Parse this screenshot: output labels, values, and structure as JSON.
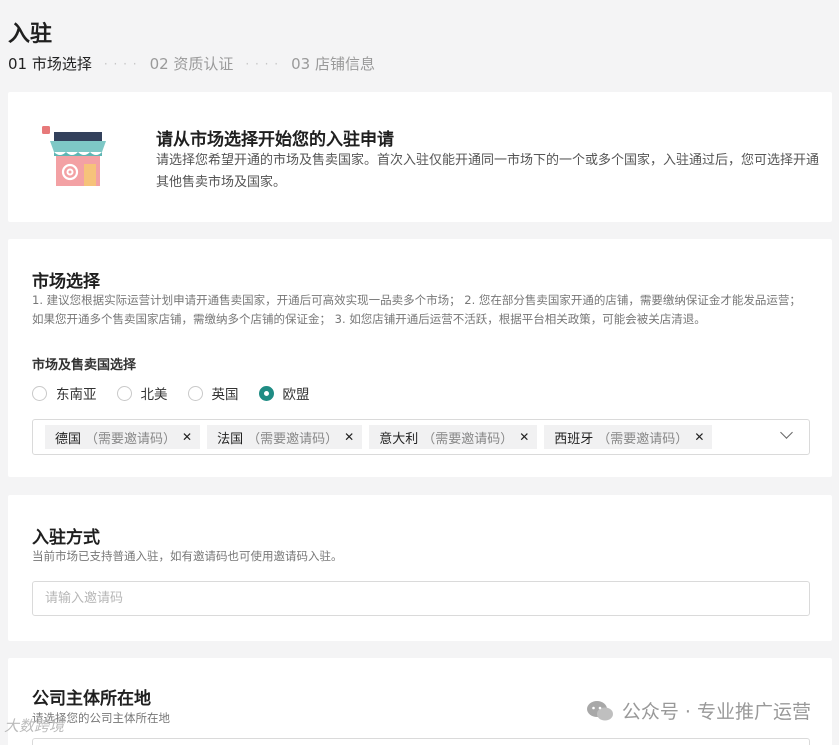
{
  "page": {
    "title": "入驻",
    "steps": [
      {
        "label": "01 市场选择"
      },
      {
        "label": "02 资质认证"
      },
      {
        "label": "03 店铺信息"
      }
    ]
  },
  "intro": {
    "icon": "shop-icon",
    "title": "请从市场选择开始您的入驻申请",
    "desc": "请选择您希望开通的市场及售卖国家。首次入驻仅能开通同一市场下的一个或多个国家，入驻通过后，您可选择开通其他售卖市场及国家。"
  },
  "market": {
    "title": "市场选择",
    "desc": "1. 建议您根据实际运营计划申请开通售卖国家，开通后可高效实现一品卖多个市场； 2. 您在部分售卖国家开通的店铺，需要缴纳保证金才能发品运营；如果您开通多个售卖国家店铺，需缴纳多个店铺的保证金； 3. 如您店铺开通后运营不活跃，根据平台相关政策，可能会被关店清退。",
    "select_label": "市场及售卖国选择",
    "options": [
      {
        "label": "东南亚",
        "checked": false
      },
      {
        "label": "北美",
        "checked": false
      },
      {
        "label": "英国",
        "checked": false
      },
      {
        "label": "欧盟",
        "checked": true
      }
    ],
    "selected_countries": [
      {
        "name": "德国",
        "note": "（需要邀请码）"
      },
      {
        "name": "法国",
        "note": "（需要邀请码）"
      },
      {
        "name": "意大利",
        "note": "（需要邀请码）"
      },
      {
        "name": "西班牙",
        "note": "（需要邀请码）"
      }
    ],
    "close_glyph": "✕",
    "accent_color": "#1f8c84"
  },
  "method": {
    "title": "入驻方式",
    "desc": "当前市场已支持普通入驻，如有邀请码也可使用邀请码入驻。",
    "invite_placeholder": "请输入邀请码",
    "invite_value": ""
  },
  "company": {
    "title": "公司主体所在地",
    "desc": "请选择您的公司主体所在地"
  },
  "watermark": {
    "text": "公众号 · 专业推广运营",
    "left_text": "大数跨境"
  }
}
